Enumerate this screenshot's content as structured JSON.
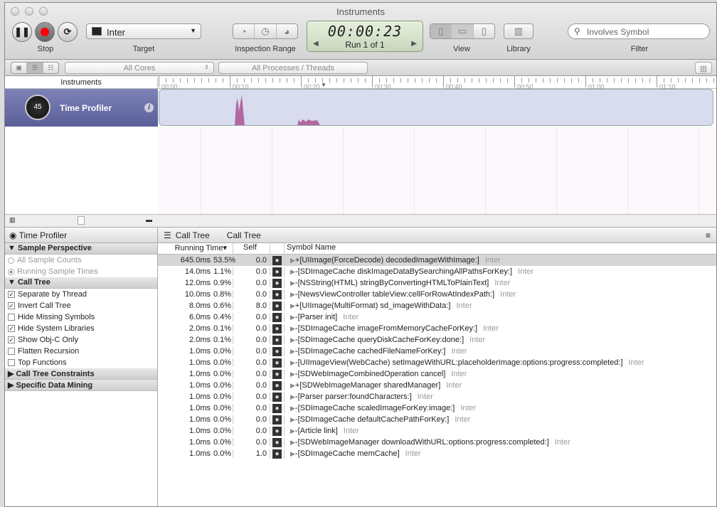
{
  "window": {
    "title": "Instruments"
  },
  "toolbar": {
    "stop_label": "Stop",
    "target_label": "Target",
    "target_value": "Inter",
    "inspection_label": "Inspection Range",
    "timer": "00:00:23",
    "run": "Run 1 of 1",
    "view_label": "View",
    "library_label": "Library",
    "filter_label": "Filter",
    "filter_placeholder": "Involves Symbol"
  },
  "bar2": {
    "cores": "All Cores",
    "processes": "All Processes / Threads"
  },
  "ruler": {
    "header": "Instruments",
    "ticks": [
      "00:00",
      "00:10",
      "00:20",
      "00:30",
      "00:40",
      "00:50",
      "01:00",
      "01:10"
    ]
  },
  "track": {
    "name": "Time Profiler",
    "badge": "45"
  },
  "left": {
    "title": "Time Profiler",
    "sections": [
      {
        "label": "Sample Perspective",
        "options": [
          {
            "label": "All Sample Counts",
            "type": "radio",
            "checked": false
          },
          {
            "label": "Running Sample Times",
            "type": "radio",
            "checked": true
          }
        ]
      },
      {
        "label": "Call Tree",
        "options": [
          {
            "label": "Separate by Thread",
            "type": "check",
            "checked": true
          },
          {
            "label": "Invert Call Tree",
            "type": "check",
            "checked": true
          },
          {
            "label": "Hide Missing Symbols",
            "type": "check",
            "checked": false
          },
          {
            "label": "Hide System Libraries",
            "type": "check",
            "checked": true
          },
          {
            "label": "Show Obj-C Only",
            "type": "check",
            "checked": true
          },
          {
            "label": "Flatten Recursion",
            "type": "check",
            "checked": false
          },
          {
            "label": "Top Functions",
            "type": "check",
            "checked": false
          }
        ]
      },
      {
        "label": "Call Tree Constraints",
        "options": []
      },
      {
        "label": "Specific Data Mining",
        "options": []
      }
    ]
  },
  "main": {
    "crumbs": [
      "Call Tree",
      "Call Tree"
    ],
    "columns": {
      "running": "Running Time",
      "self": "Self",
      "symbol": "Symbol Name"
    },
    "rows": [
      [
        "645.0ms",
        "53.5%",
        "0.0",
        "+[UIImage(ForceDecode) decodedImageWithImage:]",
        "Inter"
      ],
      [
        "14.0ms",
        "1.1%",
        "0.0",
        "-[SDImageCache diskImageDataBySearchingAllPathsForKey:]",
        "Inter"
      ],
      [
        "12.0ms",
        "0.9%",
        "0.0",
        "-[NSString(HTML) stringByConvertingHTMLToPlainText]",
        "Inter"
      ],
      [
        "10.0ms",
        "0.8%",
        "0.0",
        "-[NewsViewController tableView:cellForRowAtIndexPath:]",
        "Inter"
      ],
      [
        "8.0ms",
        "0.6%",
        "8.0",
        "+[UIImage(MultiFormat) sd_imageWithData:]",
        "Inter"
      ],
      [
        "6.0ms",
        "0.4%",
        "0.0",
        "-[Parser init]",
        "Inter"
      ],
      [
        "2.0ms",
        "0.1%",
        "0.0",
        "-[SDImageCache imageFromMemoryCacheForKey:]",
        "Inter"
      ],
      [
        "2.0ms",
        "0.1%",
        "0.0",
        "-[SDImageCache queryDiskCacheForKey:done:]",
        "Inter"
      ],
      [
        "1.0ms",
        "0.0%",
        "0.0",
        "-[SDImageCache cachedFileNameForKey:]",
        "Inter"
      ],
      [
        "1.0ms",
        "0.0%",
        "0.0",
        "-[UIImageView(WebCache) setImageWithURL:placeholderImage:options:progress:completed:]",
        "Inter"
      ],
      [
        "1.0ms",
        "0.0%",
        "0.0",
        "-[SDWebImageCombinedOperation cancel]",
        "Inter"
      ],
      [
        "1.0ms",
        "0.0%",
        "0.0",
        "+[SDWebImageManager sharedManager]",
        "Inter"
      ],
      [
        "1.0ms",
        "0.0%",
        "0.0",
        "-[Parser parser:foundCharacters:]",
        "Inter"
      ],
      [
        "1.0ms",
        "0.0%",
        "0.0",
        "-[SDImageCache scaledImageForKey:image:]",
        "Inter"
      ],
      [
        "1.0ms",
        "0.0%",
        "0.0",
        "-[SDImageCache defaultCachePathForKey:]",
        "Inter"
      ],
      [
        "1.0ms",
        "0.0%",
        "0.0",
        "-[Article link]",
        "Inter"
      ],
      [
        "1.0ms",
        "0.0%",
        "0.0",
        "-[SDWebImageManager downloadWithURL:options:progress:completed:]",
        "Inter"
      ],
      [
        "1.0ms",
        "0.0%",
        "1.0",
        "-[SDImageCache memCache]",
        "Inter"
      ]
    ]
  },
  "colors": {
    "track": "#6a6fa8",
    "graph": "#b06aa0",
    "selected_row": "#d6d6d6"
  }
}
